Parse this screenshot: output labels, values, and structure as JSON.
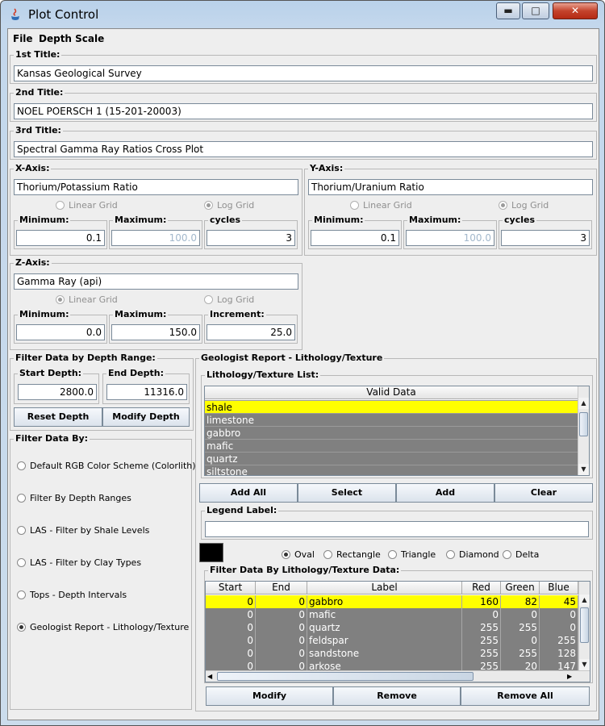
{
  "window": {
    "title": "Plot Control",
    "minimize": "▬",
    "maximize": "□",
    "close": "✕"
  },
  "menu": {
    "file": "File",
    "depth_scale": "Depth Scale"
  },
  "titles": {
    "first_label": "1st Title:",
    "first_value": "Kansas Geological Survey",
    "second_label": "2nd Title:",
    "second_value": "NOEL POERSCH 1 (15-201-20003)",
    "third_label": "3rd Title:",
    "third_value": "Spectral Gamma Ray Ratios Cross Plot"
  },
  "x_axis": {
    "label": "X-Axis:",
    "title": "Thorium/Potassium Ratio",
    "linear": "Linear Grid",
    "log": "Log Grid",
    "min_label": "Minimum:",
    "min": "0.1",
    "max_label": "Maximum:",
    "max": "100.0",
    "cycles_label": "cycles",
    "cycles": "3"
  },
  "y_axis": {
    "label": "Y-Axis:",
    "title": "Thorium/Uranium Ratio",
    "linear": "Linear Grid",
    "log": "Log Grid",
    "min_label": "Minimum:",
    "min": "0.1",
    "max_label": "Maximum:",
    "max": "100.0",
    "cycles_label": "cycles",
    "cycles": "3"
  },
  "z_axis": {
    "label": "Z-Axis:",
    "title": "Gamma Ray (api)",
    "linear": "Linear Grid",
    "log": "Log Grid",
    "min_label": "Minimum:",
    "min": "0.0",
    "max_label": "Maximum:",
    "max": "150.0",
    "inc_label": "Increment:",
    "inc": "25.0"
  },
  "depth": {
    "label": "Filter Data by Depth Range:",
    "start_label": "Start Depth:",
    "start": "2800.0",
    "end_label": "End Depth:",
    "end": "11316.0",
    "reset": "Reset Depth",
    "modify": "Modify Depth"
  },
  "filter": {
    "label": "Filter Data By:",
    "options": [
      "Default RGB Color Scheme (Colorlith)",
      "Filter By Depth Ranges",
      "LAS - Filter by Shale Levels",
      "LAS - Filter by Clay Types",
      "Tops - Depth Intervals",
      "Geologist Report - Lithology/Texture"
    ]
  },
  "geo": {
    "label": "Geologist Report - Lithology/Texture",
    "list_label": "Lithology/Texture List:",
    "list_header": "Valid Data",
    "list_items": [
      "shale",
      "limestone",
      "gabbro",
      "mafic",
      "quartz",
      "siltstone"
    ],
    "add_all": "Add All",
    "select": "Select",
    "add": "Add",
    "clear": "Clear",
    "legend_label": "Legend Label:",
    "legend_value": "",
    "swatch_color": "#000000",
    "shapes": [
      "Oval",
      "Rectangle",
      "Triangle",
      "Diamond",
      "Delta"
    ],
    "table_label": "Filter Data By Lithology/Texture Data:",
    "columns": [
      "Start",
      "End",
      "Label",
      "Red",
      "Green",
      "Blue"
    ],
    "rows": [
      [
        "0",
        "0",
        "gabbro",
        "160",
        "82",
        "45"
      ],
      [
        "0",
        "0",
        "mafic",
        "0",
        "0",
        "0"
      ],
      [
        "0",
        "0",
        "quartz",
        "255",
        "255",
        "0"
      ],
      [
        "0",
        "0",
        "feldspar",
        "255",
        "0",
        "255"
      ],
      [
        "0",
        "0",
        "sandstone",
        "255",
        "255",
        "128"
      ],
      [
        "0",
        "0",
        "arkose",
        "255",
        "20",
        "147"
      ]
    ],
    "modify": "Modify",
    "remove": "Remove",
    "remove_all": "Remove All"
  },
  "colors": {
    "selected": "#ffff00",
    "unselected": "#808080"
  }
}
